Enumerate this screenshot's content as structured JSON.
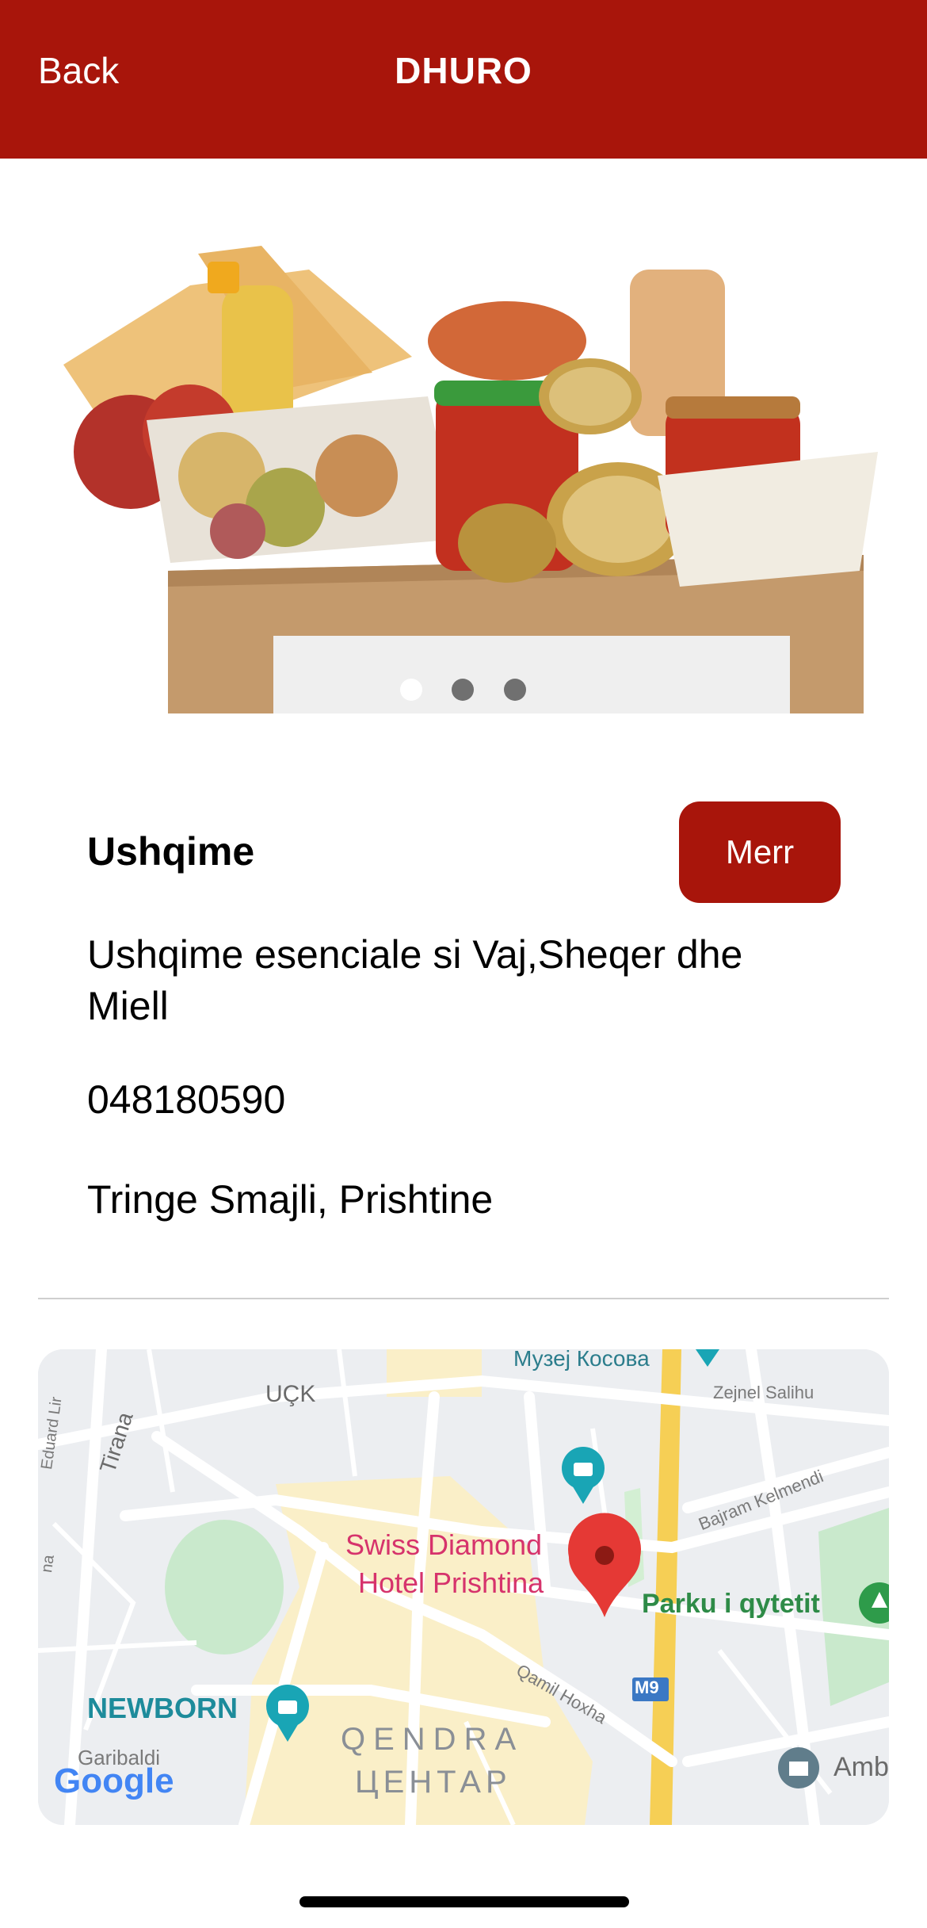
{
  "header": {
    "back_label": "Back",
    "title": "DHURO"
  },
  "carousel": {
    "dot_count": 3,
    "active_index": 0
  },
  "item": {
    "name": "Ushqime",
    "action_label": "Merr",
    "description": "Ushqime esenciale si Vaj,Sheqer dhe Miell",
    "phone": "048180590",
    "address": "Tringe Smajli, Prishtine"
  },
  "map": {
    "labels": {
      "museum": "Музеј Косова",
      "uck": "UÇK",
      "zejnel": "Zejnel Salihu",
      "tirana": "Tirana",
      "eduard": "Eduard Lir",
      "bajram": "Bajram Kelmendi",
      "hotel_line1": "Swiss Diamond",
      "hotel_line2": "Hotel Prishtina",
      "parku": "Parku i qytetit",
      "m9": "M9",
      "qamil": "Qamil Hoxha",
      "newborn": "NEWBORN",
      "qendra": "QENDRA",
      "centar": "ЦЕНТАР",
      "garibaldi": "Garibaldi",
      "amb": "Amb",
      "na": "na",
      "google": "Google"
    }
  },
  "colors": {
    "brand_red": "#a8150b",
    "map_bg": "#eceef1",
    "park_green": "#c9e9cc",
    "road_yellow": "#f6cf55"
  }
}
